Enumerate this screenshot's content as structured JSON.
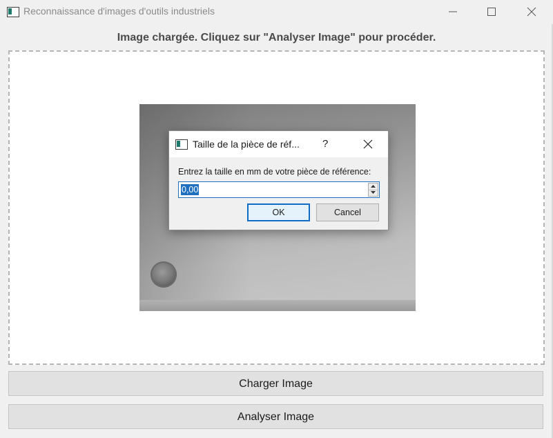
{
  "window": {
    "title": "Reconnaissance d'images d'outils industriels",
    "controls": [
      "minimize-icon",
      "maximize-icon",
      "close-icon"
    ]
  },
  "main": {
    "status": "Image chargée. Cliquez sur \"Analyser Image\" pour procéder.",
    "load_button": "Charger Image",
    "analyze_button": "Analyser Image"
  },
  "dialog": {
    "title": "Taille de la pièce de réf...",
    "help": "?",
    "prompt": "Entrez la taille en mm de votre pièce de référence:",
    "value": "0,00",
    "ok_label": "OK",
    "cancel_label": "Cancel"
  },
  "colors": {
    "accent": "#1e6fc0",
    "background": "#f0f0f0",
    "button": "#e1e1e1"
  }
}
